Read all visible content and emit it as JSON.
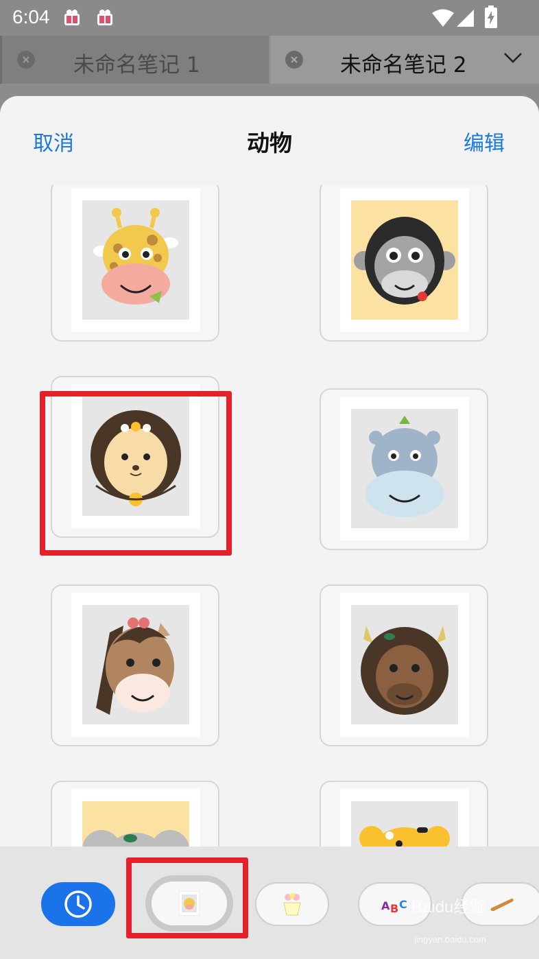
{
  "status_bar": {
    "time": "6:04"
  },
  "tabs": [
    {
      "title": "未命名笔记 1",
      "close_icon": "close-circle-icon"
    },
    {
      "title": "未命名笔记 2",
      "close_icon": "close-circle-icon",
      "menu_icon": "chevron-down-icon"
    }
  ],
  "sheet": {
    "cancel_label": "取消",
    "title": "动物",
    "edit_label": "编辑"
  },
  "stickers": [
    {
      "animal": "giraffe",
      "bg": "#e6e6e6"
    },
    {
      "animal": "gorilla",
      "bg": "#fbe2a2"
    },
    {
      "animal": "hedgehog",
      "bg": "#e6e6e6",
      "highlighted": true
    },
    {
      "animal": "hippo",
      "bg": "#e6e6e6"
    },
    {
      "animal": "horse",
      "bg": "#e6e6e6"
    },
    {
      "animal": "bison",
      "bg": "#e6e6e6"
    },
    {
      "animal": "koala",
      "bg": "#fbe2a2"
    },
    {
      "animal": "leopard",
      "bg": "#e6e6e6"
    }
  ],
  "categories": [
    {
      "name": "recent",
      "icon": "clock-icon",
      "active": true
    },
    {
      "name": "animals",
      "icon": "animal-sticker-icon",
      "selected": true
    },
    {
      "name": "plants",
      "icon": "flower-pot-icon"
    },
    {
      "name": "letters",
      "icon": "abc-icon"
    },
    {
      "name": "food",
      "icon": "bread-icon"
    }
  ],
  "watermark": {
    "text": "Baidu经验",
    "sub": "jingyan.baidu.com"
  },
  "colors": {
    "accent": "#1a7ad9",
    "highlight": "#e4202a",
    "active_pill": "#1a73e8"
  }
}
